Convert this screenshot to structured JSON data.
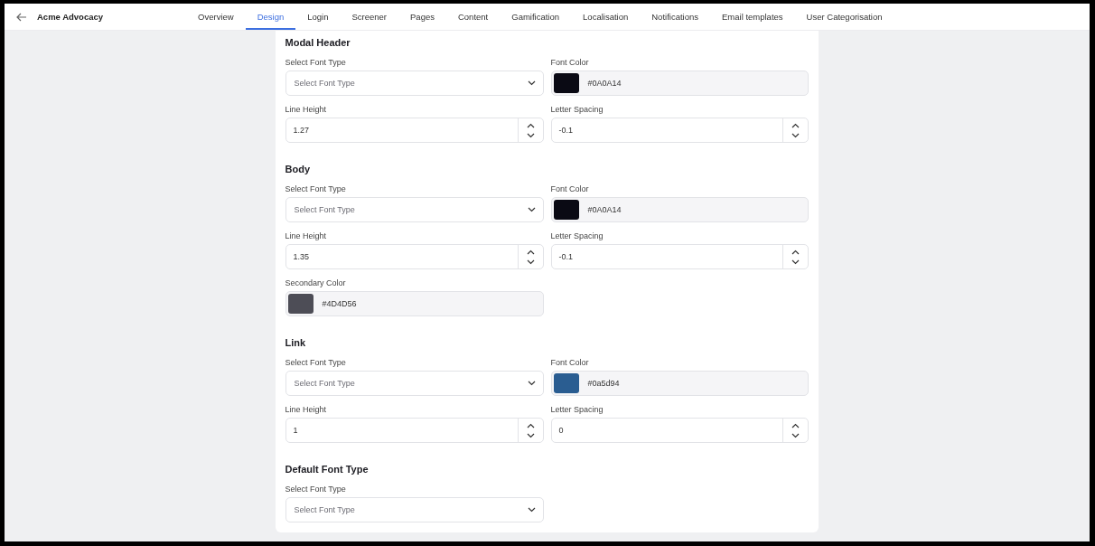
{
  "header": {
    "title": "Acme Advocacy"
  },
  "tabs": [
    {
      "label": "Overview",
      "selected": false
    },
    {
      "label": "Design",
      "selected": true
    },
    {
      "label": "Login",
      "selected": false
    },
    {
      "label": "Screener",
      "selected": false
    },
    {
      "label": "Pages",
      "selected": false
    },
    {
      "label": "Content",
      "selected": false
    },
    {
      "label": "Gamification",
      "selected": false
    },
    {
      "label": "Localisation",
      "selected": false
    },
    {
      "label": "Notifications",
      "selected": false
    },
    {
      "label": "Email templates",
      "selected": false
    },
    {
      "label": "User Categorisation",
      "selected": false
    }
  ],
  "sections": [
    {
      "title": "Modal Header",
      "fields": [
        {
          "kind": "select",
          "label": "Select Font Type",
          "placeholder": "Select Font Type"
        },
        {
          "kind": "color",
          "label": "Font Color",
          "value": "#0A0A14",
          "color": "#0a0a14"
        },
        {
          "kind": "number",
          "label": "Line Height",
          "value": "1.27"
        },
        {
          "kind": "number",
          "label": "Letter Spacing",
          "value": "-0.1"
        }
      ]
    },
    {
      "title": "Body",
      "fields": [
        {
          "kind": "select",
          "label": "Select Font Type",
          "placeholder": "Select Font Type"
        },
        {
          "kind": "color",
          "label": "Font Color",
          "value": "#0A0A14",
          "color": "#0a0a14"
        },
        {
          "kind": "number",
          "label": "Line Height",
          "value": "1.35"
        },
        {
          "kind": "number",
          "label": "Letter Spacing",
          "value": "-0.1"
        },
        {
          "kind": "color",
          "label": "Secondary Color",
          "value": "#4D4D56",
          "color": "#4d4d56"
        }
      ]
    },
    {
      "title": "Link",
      "fields": [
        {
          "kind": "select",
          "label": "Select Font Type",
          "placeholder": "Select Font Type"
        },
        {
          "kind": "color",
          "label": "Font Color",
          "value": "#0a5d94",
          "color": "#2a5d91"
        },
        {
          "kind": "number",
          "label": "Line Height",
          "value": "1"
        },
        {
          "kind": "number",
          "label": "Letter Spacing",
          "value": "0"
        }
      ]
    },
    {
      "title": "Default Font Type",
      "fields": [
        {
          "kind": "select",
          "label": "Select Font Type",
          "placeholder": "Select Font Type"
        }
      ]
    }
  ]
}
